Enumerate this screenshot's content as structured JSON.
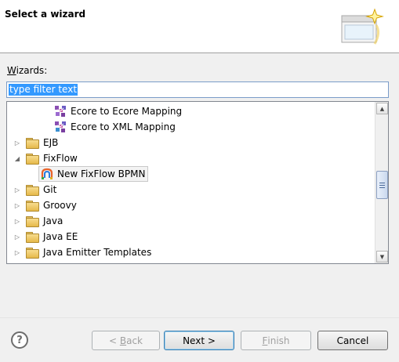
{
  "header": {
    "title": "Select a wizard",
    "banner_icon": "new-wizard-icon"
  },
  "wizards_label": {
    "mnemonic": "W",
    "rest": "izards:"
  },
  "filter": {
    "value": "type filter text"
  },
  "tree": {
    "items": [
      {
        "label": "Ecore to Ecore Mapping",
        "icon": "mapping-icon",
        "expanded": null
      },
      {
        "label": "Ecore to XML Mapping",
        "icon": "mapping-icon",
        "expanded": null
      },
      {
        "label": "EJB",
        "icon": "folder-icon",
        "expanded": false
      },
      {
        "label": "FixFlow",
        "icon": "folder-icon",
        "expanded": true
      },
      {
        "label": "New FixFlow BPMN",
        "icon": "fixflow-icon",
        "expanded": null,
        "selected": true
      },
      {
        "label": "Git",
        "icon": "folder-icon",
        "expanded": false
      },
      {
        "label": "Groovy",
        "icon": "folder-icon",
        "expanded": false
      },
      {
        "label": "Java",
        "icon": "folder-icon",
        "expanded": false
      },
      {
        "label": "Java EE",
        "icon": "folder-icon",
        "expanded": false
      },
      {
        "label": "Java Emitter Templates",
        "icon": "folder-icon",
        "expanded": false
      }
    ],
    "scrollbar": {
      "position_fraction": 0.48
    }
  },
  "buttons": {
    "back": {
      "prefix": "< ",
      "mnemonic": "B",
      "rest": "ack",
      "enabled": false
    },
    "next": {
      "label": "Next >",
      "enabled": true
    },
    "finish": {
      "mnemonic": "F",
      "rest": "inish",
      "enabled": false
    },
    "cancel": {
      "label": "Cancel",
      "enabled": true
    }
  },
  "colors": {
    "selection": "#3399ff",
    "folder": "#e6b94a"
  }
}
